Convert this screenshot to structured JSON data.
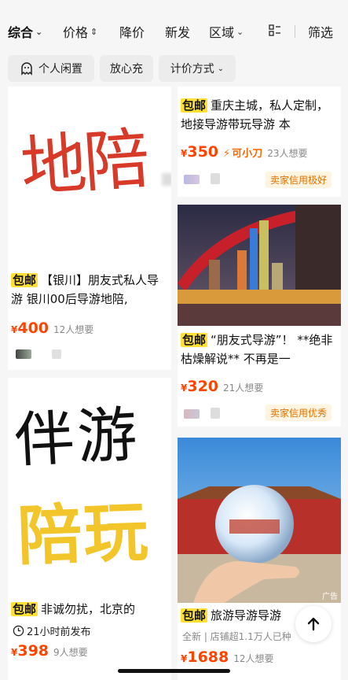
{
  "sort_bar": {
    "items": [
      "综合",
      "价格",
      "降价",
      "新发",
      "区域",
      "筛选"
    ]
  },
  "chips": [
    "个人闲置",
    "放心充",
    "计价方式"
  ],
  "cards": {
    "c1": {
      "image_text": "地陪",
      "baoyou": "包邮",
      "title": "【银川】朋友式私人导游 银川00后导游地陪,",
      "currency": "¥",
      "price": "400",
      "want": "12人想要"
    },
    "c2": {
      "baoyou": "包邮",
      "title": "重庆主城，私人定制，地接导游带玩导游 本",
      "currency": "¥",
      "price": "350",
      "cut_tag": "可小刀",
      "want": "23人想要",
      "credit": "卖家信用极好"
    },
    "c3": {
      "baoyou": "包邮",
      "title": "“朋友式导游”！ **绝非枯燥解说** 不再是一",
      "currency": "¥",
      "price": "320",
      "want": "21人想要",
      "credit": "卖家信用优秀"
    },
    "c4": {
      "image_text_top": "伴游",
      "image_text_bottom": "陪玩",
      "baoyou": "包邮",
      "title": "非诚勿扰，北京的",
      "time": "21小时前发布",
      "currency": "¥",
      "price": "398",
      "want": "9人想要"
    },
    "c5": {
      "ad": "广告",
      "baoyou": "包邮",
      "title": "旅游导游导游",
      "sub": "全新 | 店铺超1.1万人已种",
      "currency": "¥",
      "price": "1688",
      "want": "12人想要"
    }
  },
  "colors": {
    "accent": "#ff4400",
    "baoyou": "#ffe033"
  }
}
